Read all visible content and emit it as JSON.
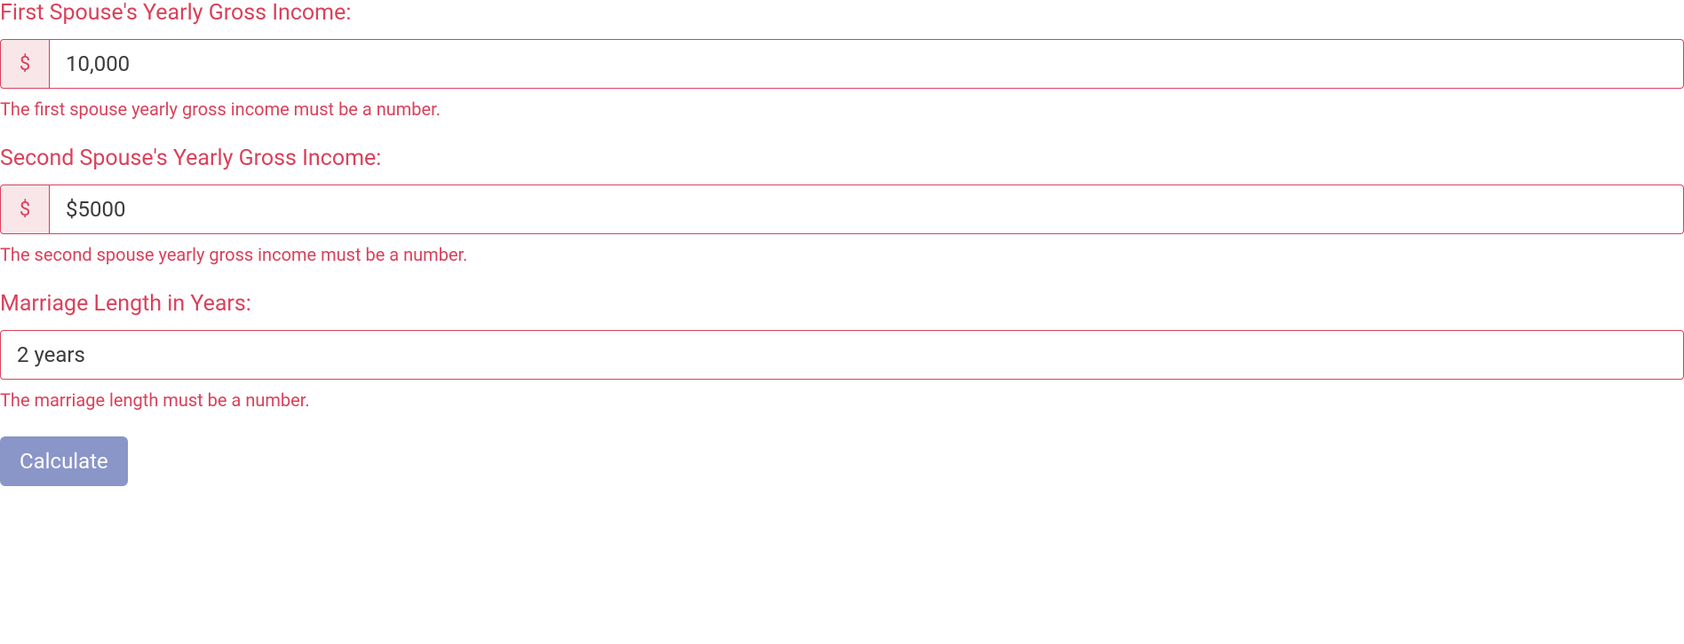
{
  "form": {
    "spouse1": {
      "label": "First Spouse's Yearly Gross Income:",
      "prefix": "$",
      "value": "10,000",
      "error": "The first spouse yearly gross income must be a number."
    },
    "spouse2": {
      "label": "Second Spouse's Yearly Gross Income:",
      "prefix": "$",
      "value": "$5000",
      "error": "The second spouse yearly gross income must be a number."
    },
    "marriage": {
      "label": "Marriage Length in Years:",
      "value": "2 years",
      "error": "The marriage length must be a number."
    },
    "submit_label": "Calculate"
  },
  "colors": {
    "error": "#d9415b",
    "addon_bg": "#f9e6e9",
    "button_bg": "#8a95c8"
  }
}
